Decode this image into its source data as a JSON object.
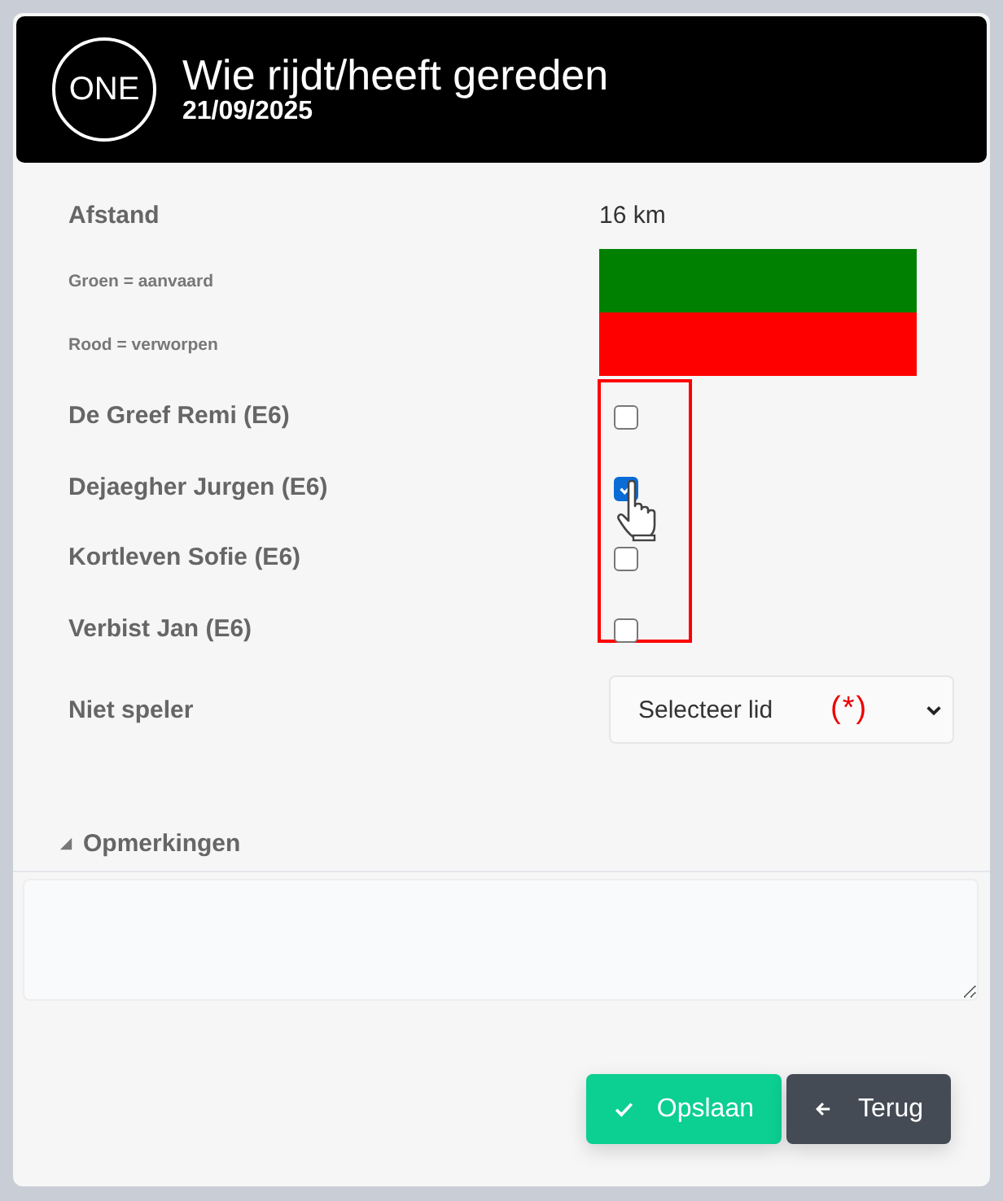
{
  "header": {
    "logo": "ONE",
    "title": "Wie rijdt/heeft gereden",
    "date": "21/09/2025"
  },
  "distance": {
    "label": "Afstand",
    "value": "16 km"
  },
  "legend": [
    {
      "label": "Groen = aanvaard",
      "color": "#008000"
    },
    {
      "label": "Rood = verworpen",
      "color": "#ff0000"
    }
  ],
  "players": [
    {
      "name": "De Greef Remi (E6)",
      "checked": false
    },
    {
      "name": "Dejaegher Jurgen (E6)",
      "checked": true
    },
    {
      "name": "Kortleven Sofie (E6)",
      "checked": false
    },
    {
      "name": "Verbist Jan (E6)",
      "checked": false
    }
  ],
  "non_player": {
    "label": "Niet speler",
    "value": "Selecteer lid",
    "annotation": "(*)"
  },
  "remarks": {
    "label": "Opmerkingen",
    "expanded": true
  },
  "buttons": [
    {
      "kind": "save",
      "label": "Opslaan"
    },
    {
      "kind": "back",
      "label": "Terug"
    }
  ]
}
